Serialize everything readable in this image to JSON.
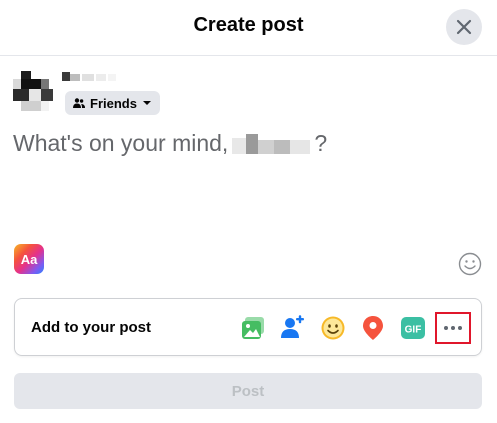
{
  "dialog": {
    "title": "Create post",
    "close_icon": "close-icon"
  },
  "author": {
    "audience_label": "Friends",
    "audience_icon": "friends-icon"
  },
  "composer": {
    "prompt_prefix": "What's on your mind,",
    "prompt_suffix": "?"
  },
  "format": {
    "text_style_label": "Aa",
    "emoji_icon": "smiley-icon"
  },
  "add_to_post": {
    "label": "Add to your post",
    "tools": [
      {
        "name": "photo-video",
        "icon": "photo-icon",
        "color": "#45bd62"
      },
      {
        "name": "tag-people",
        "icon": "tag-people-icon",
        "color": "#1877f2"
      },
      {
        "name": "feeling-activity",
        "icon": "feeling-icon",
        "color": "#f7b928"
      },
      {
        "name": "check-in",
        "icon": "location-pin-icon",
        "color": "#f5533d"
      },
      {
        "name": "gif",
        "icon": "gif-icon",
        "color": "#3bbfa3",
        "label": "GIF"
      },
      {
        "name": "more",
        "icon": "more-icon",
        "color": "#606770",
        "highlight": "#e0162b"
      }
    ]
  },
  "submit": {
    "label": "Post"
  }
}
